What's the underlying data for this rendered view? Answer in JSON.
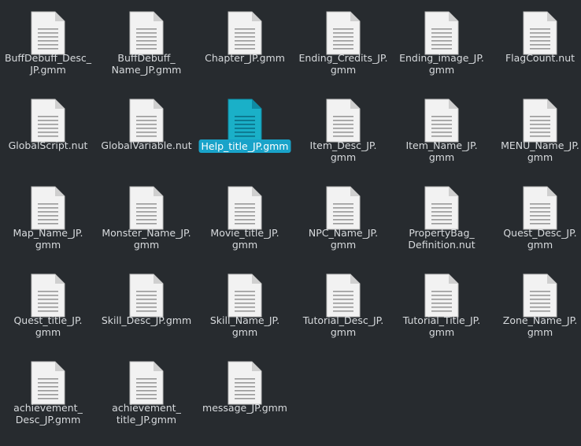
{
  "files": [
    {
      "name": "BuffDebuff_Desc_\nJP.gmm",
      "selected": false
    },
    {
      "name": "BuffDebuff_\nName_JP.gmm",
      "selected": false
    },
    {
      "name": "Chapter_JP.gmm",
      "selected": false
    },
    {
      "name": "Ending_Credits_JP.\ngmm",
      "selected": false
    },
    {
      "name": "Ending_image_JP.\ngmm",
      "selected": false
    },
    {
      "name": "FlagCount.nut",
      "selected": false
    },
    {
      "name": "GlobalScript.nut",
      "selected": false
    },
    {
      "name": "GlobalVariable.nut",
      "selected": false
    },
    {
      "name": "Help_title_JP.gmm",
      "selected": true
    },
    {
      "name": "Item_Desc_JP.\ngmm",
      "selected": false
    },
    {
      "name": "Item_Name_JP.\ngmm",
      "selected": false
    },
    {
      "name": "MENU_Name_JP.\ngmm",
      "selected": false
    },
    {
      "name": "Map_Name_JP.\ngmm",
      "selected": false
    },
    {
      "name": "Monster_Name_JP.\ngmm",
      "selected": false
    },
    {
      "name": "Movie_title_JP.\ngmm",
      "selected": false
    },
    {
      "name": "NPC_Name_JP.\ngmm",
      "selected": false
    },
    {
      "name": "PropertyBag_\nDefinition.nut",
      "selected": false
    },
    {
      "name": "Quest_Desc_JP.\ngmm",
      "selected": false
    },
    {
      "name": "Quest_title_JP.\ngmm",
      "selected": false
    },
    {
      "name": "Skill_Desc_JP.gmm",
      "selected": false
    },
    {
      "name": "Skill_Name_JP.\ngmm",
      "selected": false
    },
    {
      "name": "Tutorial_Desc_JP.\ngmm",
      "selected": false
    },
    {
      "name": "Tutorial_Title_JP.\ngmm",
      "selected": false
    },
    {
      "name": "Zone_Name_JP.\ngmm",
      "selected": false
    },
    {
      "name": "achievement_\nDesc_JP.gmm",
      "selected": false
    },
    {
      "name": "achievement_\ntitle_JP.gmm",
      "selected": false
    },
    {
      "name": "message_JP.gmm",
      "selected": false
    }
  ],
  "colors": {
    "background": "#272b2f",
    "label": "#d7dadd",
    "selection": "#19a3c9",
    "selected_icon": "#1ab0c8",
    "icon_paper": "#f2f2f2"
  },
  "icon": "text-document-icon"
}
